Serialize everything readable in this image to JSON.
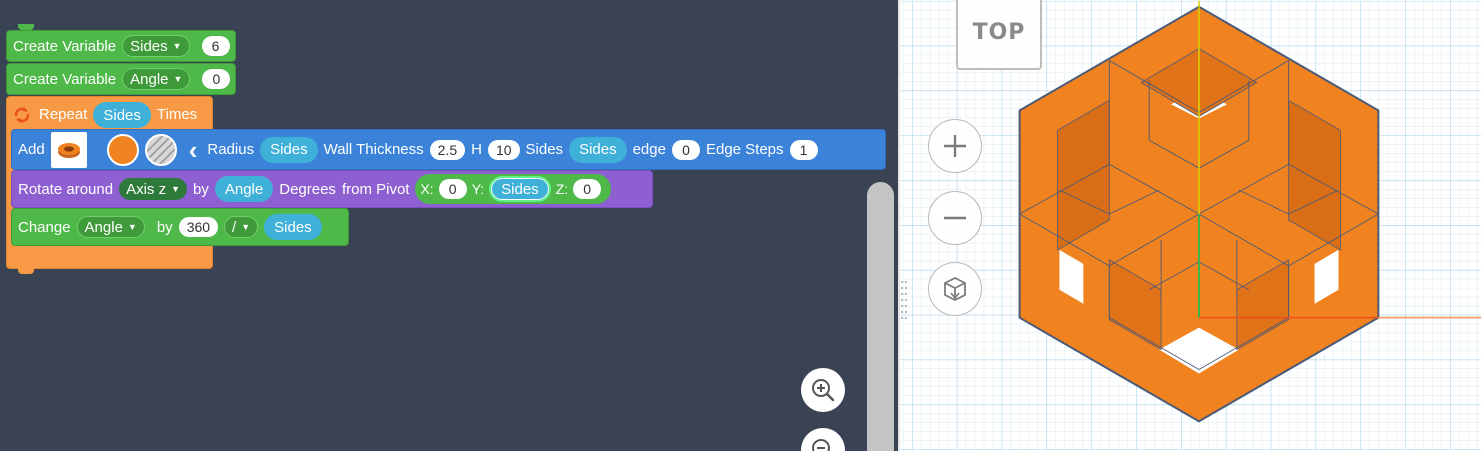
{
  "blocks": {
    "var1": {
      "label": "Create Variable",
      "name": "Sides",
      "value": "6"
    },
    "var2": {
      "label": "Create Variable",
      "name": "Angle",
      "value": "0"
    },
    "repeat": {
      "label": "Repeat",
      "var": "Sides",
      "times": "Times"
    },
    "add": {
      "label": "Add",
      "radius_label": "Radius",
      "radius_var": "Sides",
      "wall_label": "Wall Thickness",
      "wall_value": "2.5",
      "h_label": "H",
      "h_value": "10",
      "sides_label": "Sides",
      "sides_var": "Sides",
      "edge_label": "edge",
      "edge_value": "0",
      "edge_steps_label": "Edge Steps",
      "edge_steps_value": "1"
    },
    "rotate": {
      "label": "Rotate around",
      "axis": "Axis z",
      "by": "by",
      "var": "Angle",
      "degrees": "Degrees",
      "pivot": "from Pivot",
      "x_label": "X:",
      "x_value": "0",
      "y_label": "Y:",
      "y_var": "Sides",
      "z_label": "Z:",
      "z_value": "0"
    },
    "change": {
      "label": "Change",
      "var": "Angle",
      "by": "by",
      "value": "360",
      "op": "/",
      "var2": "Sides"
    }
  },
  "viewport": {
    "viewcube_label": "TOP"
  },
  "colors": {
    "workspace_bg": "#3a4354",
    "shape": "#f0831f",
    "grid": "#cfe7f2"
  }
}
